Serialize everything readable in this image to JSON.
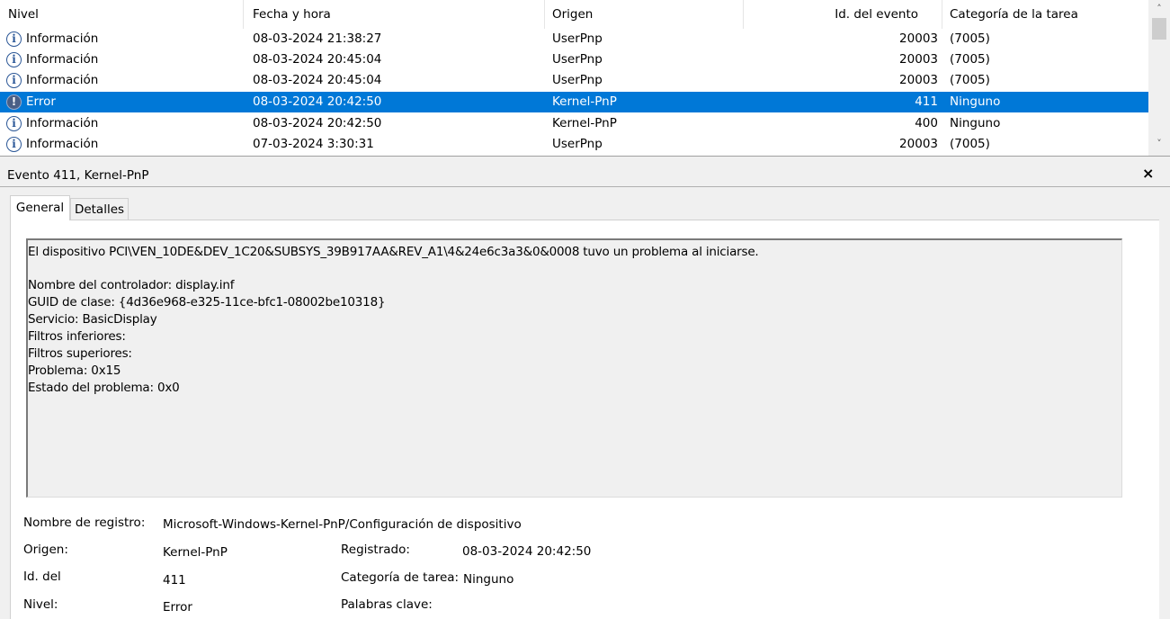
{
  "columns": {
    "level": "Nivel",
    "datetime": "Fecha y hora",
    "source": "Origen",
    "event_id": "Id. del evento",
    "task_category": "Categoría de la tarea"
  },
  "rows": [
    {
      "icon": "info-icon",
      "level": "Información",
      "datetime": "08-03-2024 21:38:27",
      "source": "UserPnp",
      "event_id": "20003",
      "task_category": "(7005)"
    },
    {
      "icon": "info-icon",
      "level": "Información",
      "datetime": "08-03-2024 20:45:04",
      "source": "UserPnp",
      "event_id": "20003",
      "task_category": "(7005)"
    },
    {
      "icon": "info-icon",
      "level": "Información",
      "datetime": "08-03-2024 20:45:04",
      "source": "UserPnp",
      "event_id": "20003",
      "task_category": "(7005)"
    },
    {
      "icon": "error-icon",
      "level": "Error",
      "datetime": "08-03-2024 20:42:50",
      "source": "Kernel-PnP",
      "event_id": "411",
      "task_category": "Ninguno",
      "selected": true
    },
    {
      "icon": "info-icon",
      "level": "Información",
      "datetime": "08-03-2024 20:42:50",
      "source": "Kernel-PnP",
      "event_id": "400",
      "task_category": "Ninguno"
    },
    {
      "icon": "info-icon",
      "level": "Información",
      "datetime": "07-03-2024 3:30:31",
      "source": "UserPnp",
      "event_id": "20003",
      "task_category": "(7005)"
    }
  ],
  "scrollbar": {
    "up": "˄",
    "down": "˅"
  },
  "detail": {
    "title": "Evento 411, Kernel-PnP",
    "close": "×",
    "tabs": {
      "general": "General",
      "details": "Detalles"
    },
    "description": {
      "line1": "El dispositivo PCI\\VEN_10DE&DEV_1C20&SUBSYS_39B917AA&REV_A1\\4&24e6c3a3&0&0008 tuvo un problema al iniciarse.",
      "line2": "Nombre del controlador: display.inf",
      "line3": "GUID de clase: {4d36e968-e325-11ce-bfc1-08002be10318}",
      "line4": "Servicio: BasicDisplay",
      "line5": "Filtros inferiores:",
      "line6": "Filtros superiores:",
      "line7": "Problema: 0x15",
      "line8": "Estado del problema: 0x0"
    },
    "fields": {
      "log_name_label": "Nombre de registro:",
      "log_name_value": "Microsoft-Windows-Kernel-PnP/Configuración de dispositivo",
      "source_label": "Origen:",
      "source_value": "Kernel-PnP",
      "logged_label": "Registrado:",
      "logged_value": "08-03-2024 20:42:50",
      "event_id_label": "Id. del",
      "event_id_value": "411",
      "task_category_label": "Categoría de tarea:",
      "task_category_value": "Ninguno",
      "level_label": "Nivel:",
      "level_value": "Error",
      "keywords_label": "Palabras clave:",
      "keywords_value": ""
    }
  }
}
